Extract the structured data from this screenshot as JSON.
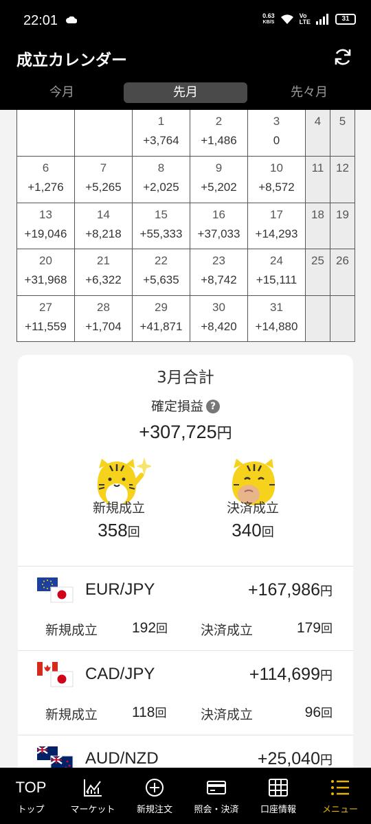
{
  "status_bar": {
    "time": "22:01",
    "net_speed_value": "0.63",
    "net_speed_unit": "KB/S",
    "volte_top": "Vo",
    "volte_bottom": "LTE",
    "battery": "31"
  },
  "header": {
    "title": "成立カレンダー",
    "tabs": [
      {
        "label": "今月",
        "active": false
      },
      {
        "label": "先月",
        "active": true
      },
      {
        "label": "先々月",
        "active": false
      }
    ]
  },
  "calendar": {
    "weeks": [
      [
        {
          "day": "",
          "amount": ""
        },
        {
          "day": "",
          "amount": ""
        },
        {
          "day": "1",
          "amount": "+3,764"
        },
        {
          "day": "2",
          "amount": "+1,486"
        },
        {
          "day": "3",
          "amount": "0"
        },
        {
          "day": "4",
          "amount": ""
        },
        {
          "day": "5",
          "amount": ""
        }
      ],
      [
        {
          "day": "6",
          "amount": "+1,276"
        },
        {
          "day": "7",
          "amount": "+5,265"
        },
        {
          "day": "8",
          "amount": "+2,025"
        },
        {
          "day": "9",
          "amount": "+5,202"
        },
        {
          "day": "10",
          "amount": "+8,572"
        },
        {
          "day": "11",
          "amount": ""
        },
        {
          "day": "12",
          "amount": ""
        }
      ],
      [
        {
          "day": "13",
          "amount": "+19,046"
        },
        {
          "day": "14",
          "amount": "+8,218"
        },
        {
          "day": "15",
          "amount": "+55,333"
        },
        {
          "day": "16",
          "amount": "+37,033"
        },
        {
          "day": "17",
          "amount": "+14,293"
        },
        {
          "day": "18",
          "amount": ""
        },
        {
          "day": "19",
          "amount": ""
        }
      ],
      [
        {
          "day": "20",
          "amount": "+31,968"
        },
        {
          "day": "21",
          "amount": "+6,322"
        },
        {
          "day": "22",
          "amount": "+5,635"
        },
        {
          "day": "23",
          "amount": "+8,742"
        },
        {
          "day": "24",
          "amount": "+15,111"
        },
        {
          "day": "25",
          "amount": ""
        },
        {
          "day": "26",
          "amount": ""
        }
      ],
      [
        {
          "day": "27",
          "amount": "+11,559"
        },
        {
          "day": "28",
          "amount": "+1,704"
        },
        {
          "day": "29",
          "amount": "+41,871"
        },
        {
          "day": "30",
          "amount": "+8,420"
        },
        {
          "day": "31",
          "amount": "+14,880"
        },
        {
          "day": "",
          "amount": ""
        },
        {
          "day": "",
          "amount": ""
        }
      ]
    ]
  },
  "summary": {
    "month_total_label": "3月合計",
    "profit_label": "確定損益",
    "help_icon": "?",
    "profit_value": "+307,725",
    "yen": "円",
    "new_label": "新規成立",
    "new_count": "358",
    "close_label": "決済成立",
    "close_count": "340",
    "count_unit": "回"
  },
  "pairs": [
    {
      "name": "EUR/JPY",
      "profit": "+167,986",
      "new_label": "新規成立",
      "new_count": "192",
      "close_label": "決済成立",
      "close_count": "179",
      "flag": "eu"
    },
    {
      "name": "CAD/JPY",
      "profit": "+114,699",
      "new_label": "新規成立",
      "new_count": "118",
      "close_label": "決済成立",
      "close_count": "96",
      "flag": "ca"
    },
    {
      "name": "AUD/NZD",
      "profit": "+25,040",
      "new_label": "新規成立",
      "new_count": "",
      "close_label": "決済成立",
      "close_count": "",
      "flag": "au"
    }
  ],
  "pair_units": {
    "yen": "円",
    "count": "回"
  },
  "bottom_nav": [
    {
      "label": "トップ",
      "top_text": "TOP",
      "icon": "top-icon"
    },
    {
      "label": "マーケット",
      "icon": "chart-icon"
    },
    {
      "label": "新規注文",
      "icon": "plus-circle-icon"
    },
    {
      "label": "照会・決済",
      "icon": "card-icon"
    },
    {
      "label": "口座情報",
      "icon": "grid-icon"
    },
    {
      "label": "メニュー",
      "icon": "menu-icon",
      "active": true
    }
  ],
  "colors": {
    "accent": "#e8b400",
    "header_bg": "#000000",
    "tab_active_bg": "#4a4a4a"
  }
}
